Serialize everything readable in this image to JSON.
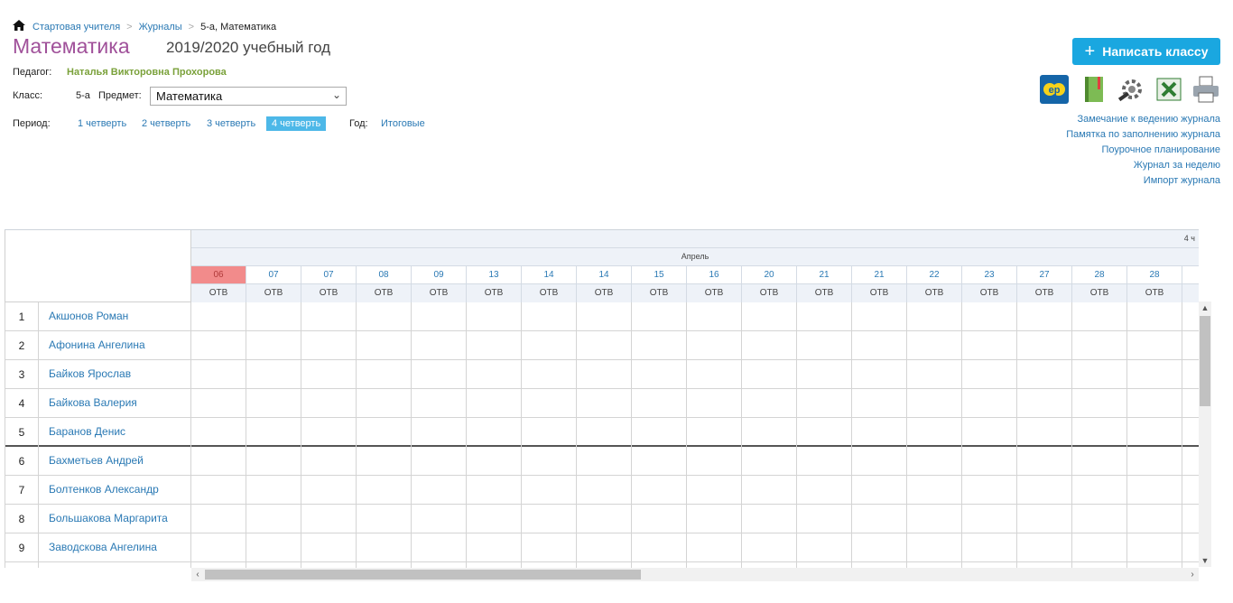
{
  "breadcrumb": {
    "home": "Стартовая учителя",
    "journals": "Журналы",
    "current": "5-а, Математика"
  },
  "header": {
    "title": "Математика",
    "year": "2019/2020 учебный год"
  },
  "teacher": {
    "label": "Педагог:",
    "name": "Наталья Викторовна Прохорова"
  },
  "klass": {
    "label": "Класс:",
    "value": "5-а",
    "subject_label": "Предмет:",
    "subject_value": "Математика"
  },
  "period": {
    "label": "Период:",
    "items": [
      "1 четверть",
      "2 четверть",
      "3 четверть",
      "4 четверть"
    ],
    "active": "4 четверть",
    "year_label": "Год:",
    "year_value": "Итоговые"
  },
  "actions": {
    "write_class": "Написать классу"
  },
  "side_links": [
    "Замечание к ведению журнала",
    "Памятка по заполнению журнала",
    "Поурочное планирование",
    "Журнал за неделю",
    "Импорт журнала"
  ],
  "grid": {
    "quarter": "4 ч",
    "month": "Апрель",
    "dates": [
      "06",
      "07",
      "07",
      "08",
      "09",
      "13",
      "14",
      "14",
      "15",
      "16",
      "20",
      "21",
      "21",
      "22",
      "23",
      "27",
      "28",
      "28"
    ],
    "type_label": "ОТВ",
    "highlighted_index": 0,
    "students": [
      {
        "n": "1",
        "name": "Акшонов Роман"
      },
      {
        "n": "2",
        "name": "Афонина Ангелина"
      },
      {
        "n": "3",
        "name": "Байков Ярослав"
      },
      {
        "n": "4",
        "name": "Байкова Валерия"
      },
      {
        "n": "5",
        "name": "Баранов Денис"
      },
      {
        "n": "6",
        "name": "Бахметьев Андрей"
      },
      {
        "n": "7",
        "name": "Болтенков Александр"
      },
      {
        "n": "8",
        "name": "Большакова Маргарита"
      },
      {
        "n": "9",
        "name": "Заводскова Ангелина"
      }
    ]
  },
  "colors": {
    "title": "#a0519a",
    "accent": "#1aa7e0",
    "active_period": "#4db8e8",
    "highlight_date": "#f28b8b",
    "teacher": "#7aa13a"
  }
}
